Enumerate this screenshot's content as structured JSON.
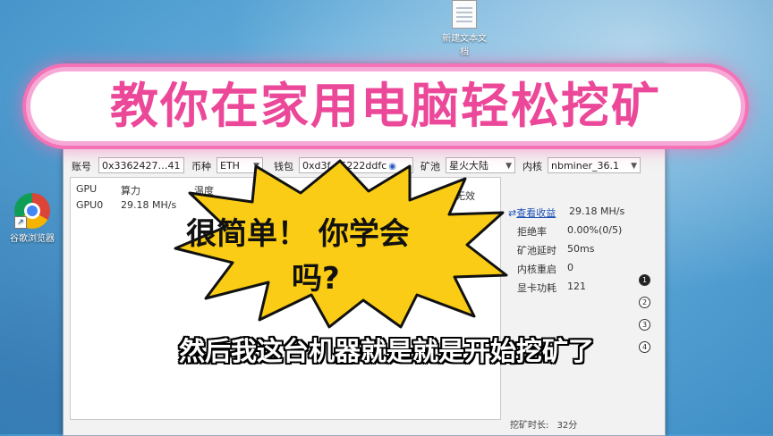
{
  "desktop": {
    "icons": [
      {
        "label_line1": "新建文本文",
        "label_line2": "档",
        "icon": "text-file-icon"
      },
      {
        "label": "谷歌浏览器",
        "icon": "chrome-icon"
      }
    ]
  },
  "toolbar": {
    "account_label": "账号",
    "account_value": "0x3362427…41",
    "currency_label": "币种",
    "currency_value": "ETH",
    "wallet_label": "钱包",
    "wallet_value": "0xd3f…5222ddfc",
    "pool_label": "矿池",
    "pool_value": "星火大陆",
    "kernel_label": "内核",
    "kernel_value": "nbminer_36.1"
  },
  "gpu_table": {
    "headers": [
      "GPU",
      "算力",
      "温度",
      "无效"
    ],
    "rows": [
      {
        "gpu": "GPU0",
        "hashrate": "29.18 MH/s"
      }
    ]
  },
  "stats": {
    "view_earnings": "查看收益",
    "hashrate_value": "29.18 MH/s",
    "rows": [
      {
        "label": "拒绝率",
        "value": "0.00%(0/5)"
      },
      {
        "label": "矿池延时",
        "value": "50ms"
      },
      {
        "label": "内核重启",
        "value": "0"
      },
      {
        "label": "显卡功耗",
        "value": "121"
      }
    ],
    "steps": [
      "1",
      "2",
      "3",
      "4"
    ]
  },
  "footer": {
    "mining_time_label": "挖矿时长:",
    "mining_time_value": "32分"
  },
  "overlay": {
    "banner": "教你在家用电脑轻松挖矿",
    "burst_line1": "很简单！ 你学会",
    "burst_line2": "吗?",
    "subtitle": "然后我这台机器就是就是开始挖矿了"
  },
  "colors": {
    "banner_text": "#ec4899",
    "banner_glow": "#f472b6",
    "burst_fill": "#facc15",
    "link": "#1d4fb4"
  }
}
